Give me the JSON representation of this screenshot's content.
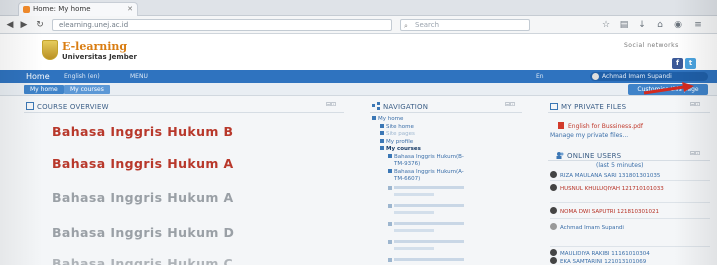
{
  "browser": {
    "tab_title": "Home: My home",
    "address": "elearning.unej.ac.id",
    "search_placeholder": "Search"
  },
  "site": {
    "logo_title": "E-learning",
    "logo_sub": "Universitas Jember",
    "social_label": "Social networks"
  },
  "nav": {
    "home": "Home",
    "menu1": "English (en)",
    "menu2": "MENU",
    "lang": "En",
    "user": "Achmad Imam Supandi"
  },
  "breadcrumb": [
    "My home",
    "My courses"
  ],
  "edit_button": "Customise this page",
  "course_overview": {
    "title": "COURSE OVERVIEW",
    "courses": [
      {
        "name": "Bahasa Inggris Hukum B",
        "color": "#b8382b"
      },
      {
        "name": "Bahasa Inggris Hukum A",
        "color": "#b8382b"
      },
      {
        "name": "Bahasa Inggris Hukum A",
        "color": "#9aa0a6"
      },
      {
        "name": "Bahasa Inggris Hukum D",
        "color": "#9aa0a6"
      },
      {
        "name": "Bahasa Inggris Hukum C",
        "color": "#aeb3b8"
      }
    ]
  },
  "navigation": {
    "title": "NAVIGATION",
    "items": [
      {
        "label": "My home"
      },
      {
        "label": "Site home"
      },
      {
        "label": "Site pages"
      },
      {
        "label": "My profile"
      },
      {
        "label": "My courses"
      },
      {
        "label": "Bahasa Inggris Hukum(B-"
      },
      {
        "label": "TM-9376)"
      },
      {
        "label": "Bahasa Inggris Hukum(A-"
      },
      {
        "label": "TM-6607)"
      }
    ]
  },
  "private_files": {
    "title": "MY PRIVATE FILES",
    "file": "English for Bussiness.pdf",
    "manage": "Manage my private files..."
  },
  "online_users": {
    "title": "ONLINE USERS",
    "subtitle": "(last 5 minutes)",
    "users": [
      "RIZA MAULANA SARI 131801301035",
      "HUSNUL KHULUQIYAH 121710101033",
      "NOMA DWI SAPUTRI 121810301021",
      "Achmad Imam Supandi",
      "MAULIDIYA RAKIBI 11161010304",
      "EKA SAMTARINI 121013101069"
    ]
  }
}
